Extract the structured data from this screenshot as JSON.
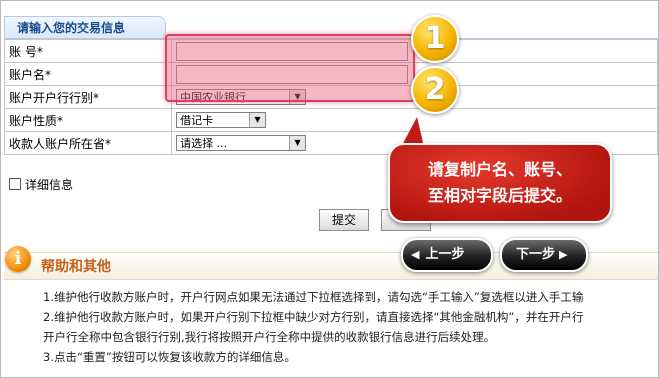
{
  "form": {
    "tab_title": "请输入您的交易信息",
    "rows": [
      {
        "label": "账 号*"
      },
      {
        "label": "账户名*"
      },
      {
        "label": "账户开户行行别*",
        "select_value": "中国农业银行"
      },
      {
        "label": "账户性质*",
        "select_value": "借记卡"
      },
      {
        "label": "收款人账户所在省*",
        "select_value": "请选择 ..."
      }
    ],
    "detail_label": "详细信息",
    "submit_label": "提交"
  },
  "help": {
    "icon_glyph": "i",
    "title": "帮助和其他",
    "lines": [
      "1.维护他行收款方账户时，开户行网点如果无法通过下拉框选择到，请勾选“手工输入”复选框以进入手工输",
      "2.维护他行收款方账户时，如果开户行别下拉框中缺少对方行别，请直接选择“其他金融机构”，并在开户行",
      "开户行全称中包含银行行别,我行将按照开户行全称中提供的收款银行信息进行后续处理。",
      "3.点击“重置”按钮可以恢复该收款方的详细信息。"
    ]
  },
  "overlay": {
    "badge1": "1",
    "badge2": "2",
    "callout_line1": "请复制户名、账号、",
    "callout_line2": "至相对字段后提交。",
    "prev_label": "上一步",
    "next_label": "下一步"
  },
  "colors": {
    "highlight": "#ec607c",
    "badge": "#f5b400",
    "callout": "#c21a14",
    "help_title": "#c5611a",
    "form_tab_text": "#1a4b8c"
  }
}
